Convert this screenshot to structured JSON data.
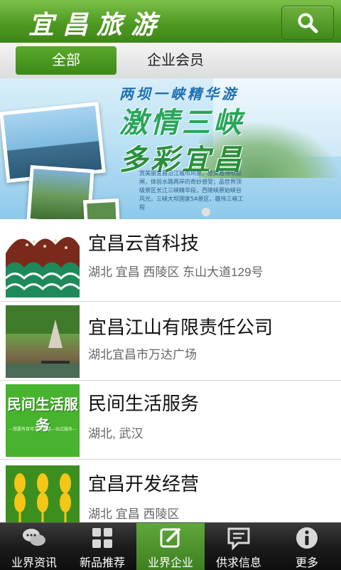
{
  "header": {
    "title": "宜昌旅游",
    "search_icon": "search-icon"
  },
  "tabs": [
    {
      "label": "全部",
      "active": true
    },
    {
      "label": "企业会员",
      "active": false
    }
  ],
  "banner": {
    "line1": "两坝一峡精华游",
    "line2": "激情三峡",
    "line3": "多彩宜昌",
    "description": "赏美丽宜昌沿江城市风景，感受葛洲坝船闸，体验水路两岸的奇妙感受；品世界顶级景区长江三峡精华段，西陵峡原始峡谷风光，三峡大坝国家5A景区，雄伟三峡工程"
  },
  "list": [
    {
      "title": "宜昌云首科技",
      "address": "湖北 宜昌 西陵区 东山大道129号"
    },
    {
      "title": "宜昌江山有限责任公司",
      "address": "湖北宜昌市万达广场"
    },
    {
      "title": " 民间生活服务",
      "address": "湖北, 武汉",
      "thumb_text": "民间生活服务",
      "thumb_subtext": "—想要有目可寻打电话—站式服务—"
    },
    {
      "title": "宜昌开发经营",
      "address": "湖北 宜昌 西陵区"
    }
  ],
  "bottom_nav": [
    {
      "label": "业界资讯",
      "icon": "chat-bubbles-icon",
      "active": false
    },
    {
      "label": "新品推荐",
      "icon": "grid-icon",
      "active": false
    },
    {
      "label": "业界企业",
      "icon": "edit-icon",
      "active": true
    },
    {
      "label": "供求信息",
      "icon": "message-icon",
      "active": false
    },
    {
      "label": "更多",
      "icon": "info-icon",
      "active": false
    }
  ],
  "colors": {
    "brand_green": "#4f9a22",
    "nav_dark": "#1c1c1c"
  }
}
